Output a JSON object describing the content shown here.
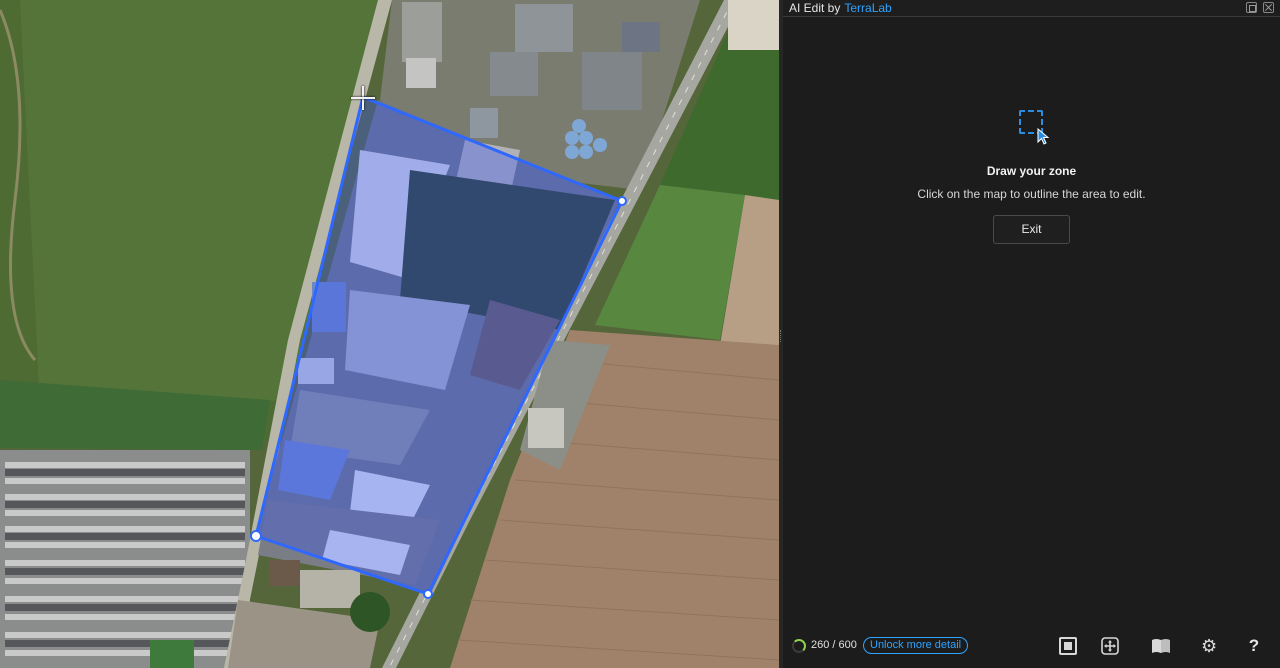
{
  "panel": {
    "title": "AI Edit by",
    "brand": "TerraLab",
    "heading": "Draw your zone",
    "description": "Click on the map to outline the area to edit.",
    "exit_label": "Exit"
  },
  "footer": {
    "count": "260 / 600",
    "unlock_label": "Unlock more detail",
    "help_glyph": "?",
    "gear_glyph": "⚙"
  },
  "colors": {
    "accent": "#2fa3ff",
    "selection": "#2b5fff",
    "panel_bg": "#1c1c1c",
    "progress": "#8fd14f"
  },
  "icons": [
    "dock-icon",
    "close-icon",
    "zone-select-icon",
    "cursor-icon",
    "square-icon",
    "move-icon",
    "book-icon",
    "gear-icon",
    "help-icon"
  ]
}
